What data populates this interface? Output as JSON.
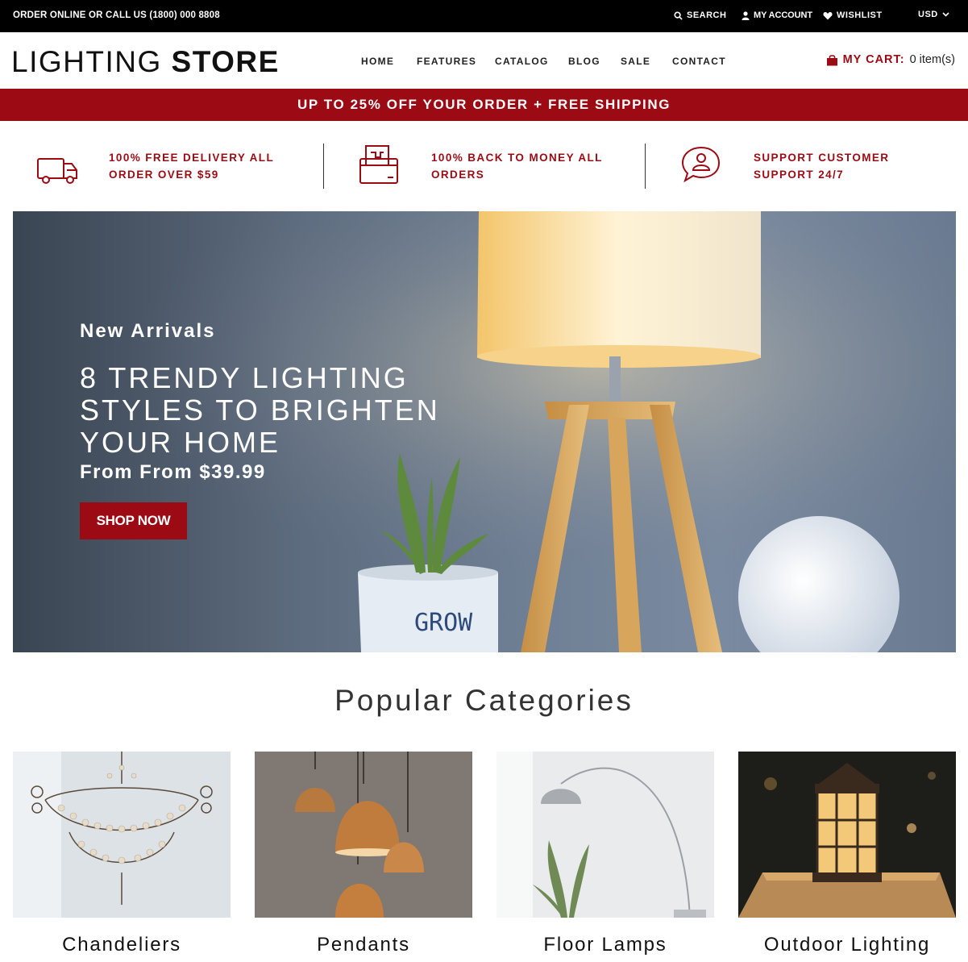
{
  "topbar": {
    "phone_text": "ORDER ONLINE OR CALL US (1800) 000 8808",
    "search_label": "SEARCH",
    "account_label": "MY ACCOUNT",
    "wishlist_label": "WISHLIST",
    "currency": "USD"
  },
  "header": {
    "logo_light": "LIGHTING",
    "logo_bold": "STORE",
    "nav": [
      "HOME",
      "FEATURES",
      "CATALOG",
      "BLOG",
      "SALE",
      "CONTACT"
    ],
    "cart_label": "MY CART:",
    "cart_count": "0 item(s)"
  },
  "promo": {
    "text": "UP TO 25% OFF YOUR ORDER + FREE SHIPPING"
  },
  "features": [
    {
      "icon": "delivery-truck-icon",
      "line1": "100% FREE DELIVERY ALL",
      "line2": "ORDER OVER $59"
    },
    {
      "icon": "money-box-icon",
      "line1": "100% BACK TO MONEY ALL",
      "line2": "ORDERS"
    },
    {
      "icon": "support-chat-icon",
      "line1": "SUPPORT CUSTOMER",
      "line2": "SUPPORT 24/7"
    }
  ],
  "hero": {
    "eyebrow": "New Arrivals",
    "headline_lines": [
      "8 TRENDY LIGHTING",
      "STYLES TO BRIGHTEN",
      "YOUR HOME"
    ],
    "price": "From From $39.99",
    "button": "SHOP NOW",
    "pot_text": "GROW"
  },
  "categories": {
    "title": "Popular Categories",
    "items": [
      {
        "name": "Chandeliers"
      },
      {
        "name": "Pendants"
      },
      {
        "name": "Floor Lamps"
      },
      {
        "name": "Outdoor Lighting"
      }
    ]
  },
  "colors": {
    "accent": "#9c0b13",
    "topbar_bg": "#000000"
  }
}
